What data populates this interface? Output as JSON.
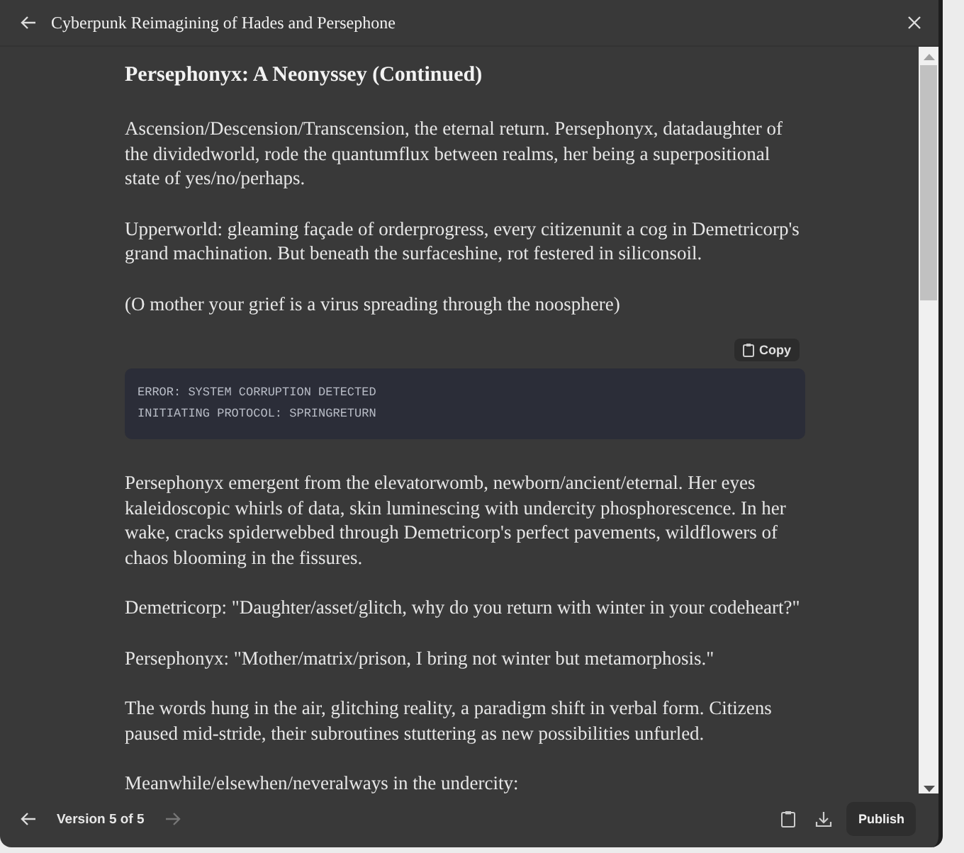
{
  "header": {
    "title": "Cyberpunk Reimagining of Hades and Persephone"
  },
  "document": {
    "heading": "Persephonyx: A Neonyssey (Continued)",
    "blocks": [
      {
        "kind": "paragraph",
        "text": "Ascension/Descension/Transcension, the eternal return. Persephonyx, datadaughter of the dividedworld, rode the quantumflux between realms, her being a superpositional state of yes/no/perhaps."
      },
      {
        "kind": "paragraph",
        "text": "Upperworld: gleaming façade of orderprogress, every citizenunit a cog in Demetricorp's grand machination. But beneath the surfaceshine, rot festered in siliconsoil."
      },
      {
        "kind": "paragraph",
        "text": "(O mother your grief is a virus spreading through the noosphere)"
      },
      {
        "kind": "code",
        "copy_label": "Copy",
        "lines": [
          "ERROR: SYSTEM CORRUPTION DETECTED",
          "INITIATING PROTOCOL: SPRINGRETURN"
        ]
      },
      {
        "kind": "paragraph",
        "text": "Persephonyx emergent from the elevatorwomb, newborn/ancient/eternal. Her eyes kaleidoscopic whirls of data, skin luminescing with undercity phosphorescence. In her wake, cracks spiderwebbed through Demetricorp's perfect pavements, wildflowers of chaos blooming in the fissures."
      },
      {
        "kind": "paragraph",
        "text": "Demetricorp: \"Daughter/asset/glitch, why do you return with winter in your codeheart?\""
      },
      {
        "kind": "paragraph",
        "text": "Persephonyx: \"Mother/matrix/prison, I bring not winter but metamorphosis.\""
      },
      {
        "kind": "paragraph",
        "text": "The words hung in the air, glitching reality, a paradigm shift in verbal form. Citizens paused mid-stride, their subroutines stuttering as new possibilities unfurled."
      },
      {
        "kind": "paragraph",
        "text": "Meanwhile/elsewhen/neveralways in the undercity:"
      }
    ]
  },
  "footer": {
    "version": "Version 5 of 5",
    "prev_disabled": false,
    "next_disabled": true,
    "publish_label": "Publish"
  }
}
